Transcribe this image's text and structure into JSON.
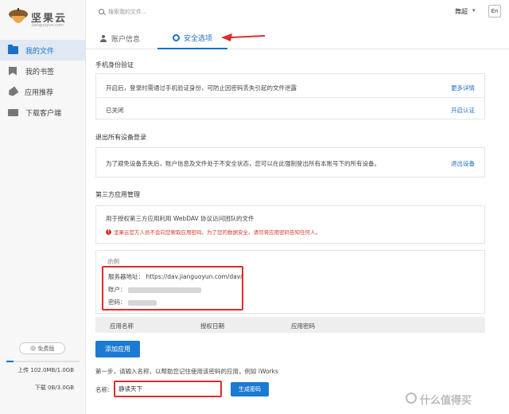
{
  "app": {
    "logo_name": "坚果云",
    "logo_sub": "jianguoyun.com"
  },
  "sidebar": {
    "items": [
      {
        "label": "我的文件",
        "icon": "folder-icon",
        "active": true
      },
      {
        "label": "我的书签",
        "icon": "bookmark-icon",
        "active": false
      },
      {
        "label": "应用推荐",
        "icon": "tag-icon",
        "active": false
      },
      {
        "label": "下载客户端",
        "icon": "monitor-icon",
        "active": false
      }
    ],
    "plan_label": "免费版",
    "upload_text": "上传 102.0MB/1.0GB",
    "upload_fraction": 0.1,
    "download_text": "下载 0B/3.0GB"
  },
  "header": {
    "search_placeholder": "搜索我的文件...",
    "user_name": "舞超",
    "user_caret": "▾",
    "lang": "En"
  },
  "tabs": {
    "account": "账户信息",
    "security": "安全选项"
  },
  "phone_verify": {
    "title": "手机身份验证",
    "description": "开启后，登录时需通过手机验证身份，可防止因密码丢失引起的文件泄露",
    "more_link": "更多详情",
    "status": "已关闭",
    "enable_link": "开启认证"
  },
  "logout_all": {
    "title": "退出所有设备登录",
    "description": "为了避免设备丢失后，账户信息及文件处于不安全状态，您可以在此强制登出所有本账号下的所有设备。",
    "action_link": "退出设备"
  },
  "third_party": {
    "title": "第三方应用管理",
    "description": "用于授权第三方应用利用 WebDAV 协议访问团队的文件",
    "warning": "坚果云官方人员不会向您索取应用密码。为了您的数据安全，请勿将应用密码告知任何人。",
    "example_label": "示例",
    "server_label": "服务器地址：",
    "server_url": "https://dav.jianguoyun.com/dav/",
    "account_label": "账户：",
    "password_label": "密码：",
    "columns": [
      "应用名称",
      "授权日期",
      "应用密码"
    ],
    "add_button": "添加应用",
    "step_text": "第一步，请输入名称，以帮助您记住使用该密码的应用，例如 iWorks",
    "name_label": "名称:",
    "name_value": "静读天下",
    "generate_button": "生成密码"
  },
  "watermark": "什么值得买"
}
